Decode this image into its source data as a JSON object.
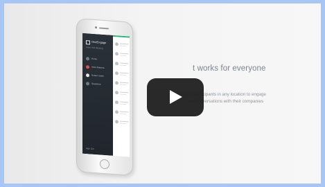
{
  "video": {
    "headline": "t works for everyone",
    "description_lines": [
      "gi          app for participants in any location to engage",
      "nal conversations with their companies"
    ]
  },
  "phone_app": {
    "brand": "OneEngage",
    "brand_sub": "Town Hall Meeting",
    "drawer_items": [
      {
        "label": "Home",
        "dot_color": "#6f7a85"
      },
      {
        "label": "Anna Roberts",
        "dot_color": "#d9534f"
      },
      {
        "label": "Robert Smith",
        "dot_color": "#e6e6e6"
      },
      {
        "label": "Questions",
        "dot_color": "#6f7a85"
      },
      {
        "label": "Settings",
        "dot_color": "#6f7a85"
      }
    ],
    "footer": "Sign Out",
    "accent_color": "#2ab673"
  },
  "icons": {
    "play": "play-icon"
  }
}
